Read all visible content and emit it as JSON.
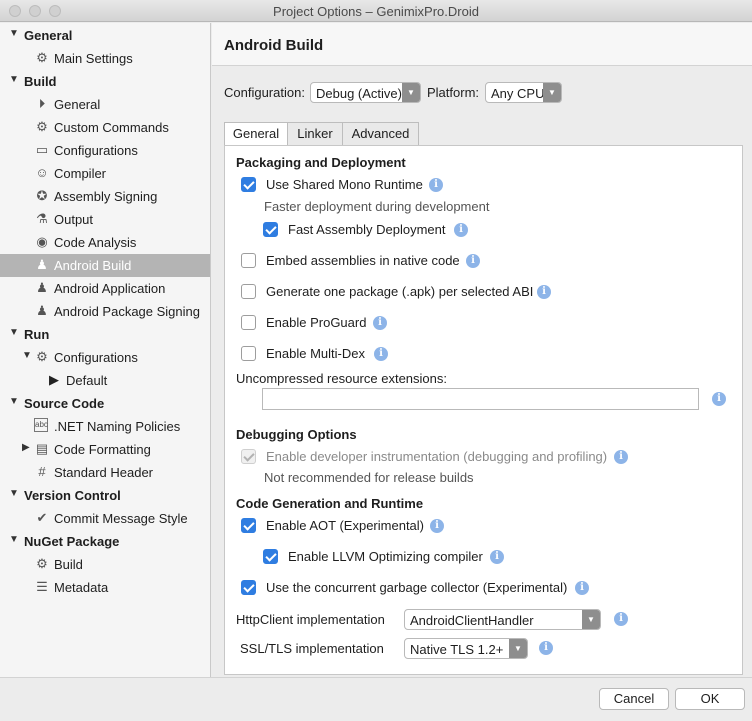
{
  "window": {
    "title": "Project Options – GenimixPro.Droid"
  },
  "sidebar": {
    "rows": [
      {
        "label": "General",
        "section": true,
        "expanded": true
      },
      {
        "label": "Main Settings",
        "icon": "gear-icon"
      },
      {
        "label": "Build",
        "section": true,
        "expanded": true
      },
      {
        "label": "General",
        "icon": "play-bar-icon"
      },
      {
        "label": "Custom Commands",
        "icon": "gear-icon"
      },
      {
        "label": "Configurations",
        "icon": "window-icon"
      },
      {
        "label": "Compiler",
        "icon": "robot-icon"
      },
      {
        "label": "Assembly Signing",
        "icon": "seal-icon"
      },
      {
        "label": "Output",
        "icon": "flask-icon"
      },
      {
        "label": "Code Analysis",
        "icon": "target-icon"
      },
      {
        "label": "Android Build",
        "icon": "android-icon",
        "selected": true
      },
      {
        "label": "Android Application",
        "icon": "android-icon"
      },
      {
        "label": "Android Package Signing",
        "icon": "android-icon"
      },
      {
        "label": "Run",
        "section": true,
        "expanded": true
      },
      {
        "label": "Configurations",
        "icon": "gear-icon",
        "expanded": true
      },
      {
        "label": "Default",
        "icon": "play-icon"
      },
      {
        "label": "Source Code",
        "section": true,
        "expanded": true
      },
      {
        "label": ".NET Naming Policies",
        "icon": "abc-icon"
      },
      {
        "label": "Code Formatting",
        "icon": "document-icon",
        "collapsed": true
      },
      {
        "label": "Standard Header",
        "icon": "hash-icon"
      },
      {
        "label": "Version Control",
        "section": true,
        "expanded": true
      },
      {
        "label": "Commit Message Style",
        "icon": "check-circle-icon"
      },
      {
        "label": "NuGet Package",
        "section": true,
        "expanded": true
      },
      {
        "label": "Build",
        "icon": "gear-icon"
      },
      {
        "label": "Metadata",
        "icon": "list-icon"
      }
    ]
  },
  "main": {
    "title": "Android Build",
    "configuration_label": "Configuration:",
    "configuration_value": "Debug (Active)",
    "platform_label": "Platform:",
    "platform_value": "Any CPU",
    "tabs": [
      {
        "label": "General",
        "active": true
      },
      {
        "label": "Linker"
      },
      {
        "label": "Advanced"
      }
    ]
  },
  "general_tab": {
    "packaging": {
      "heading": "Packaging and Deployment",
      "shared_mono": {
        "label": "Use Shared Mono Runtime",
        "checked": true
      },
      "shared_mono_hint": "Faster deployment during development",
      "fast_deploy": {
        "label": "Fast Assembly Deployment",
        "checked": true
      },
      "embed_assemblies": {
        "label": "Embed assemblies in native code",
        "checked": false
      },
      "per_abi": {
        "label": "Generate one package (.apk) per selected ABI",
        "checked": false
      },
      "proguard": {
        "label": "Enable ProGuard",
        "checked": false
      },
      "multidex": {
        "label": "Enable Multi-Dex",
        "checked": false
      },
      "uncompressed_label": "Uncompressed resource extensions:",
      "uncompressed_value": ""
    },
    "debugging": {
      "heading": "Debugging Options",
      "instrumentation": {
        "label": "Enable developer instrumentation (debugging and profiling)",
        "checked": true,
        "disabled": true
      },
      "instrumentation_hint": "Not recommended for release builds"
    },
    "codegen": {
      "heading": "Code Generation and Runtime",
      "aot": {
        "label": "Enable AOT (Experimental)",
        "checked": true
      },
      "llvm": {
        "label": "Enable LLVM Optimizing compiler",
        "checked": true
      },
      "concurrent_gc": {
        "label": "Use the concurrent garbage collector (Experimental)",
        "checked": true
      },
      "httpclient_label": "HttpClient implementation",
      "httpclient_value": "AndroidClientHandler",
      "ssl_label": "SSL/TLS implementation",
      "ssl_value": "Native TLS 1.2+"
    }
  },
  "footer": {
    "cancel_label": "Cancel",
    "ok_label": "OK"
  },
  "colors": {
    "accent": "#2f7de1",
    "selected_row": "#b4b4b4",
    "info": "#8db4e8"
  }
}
